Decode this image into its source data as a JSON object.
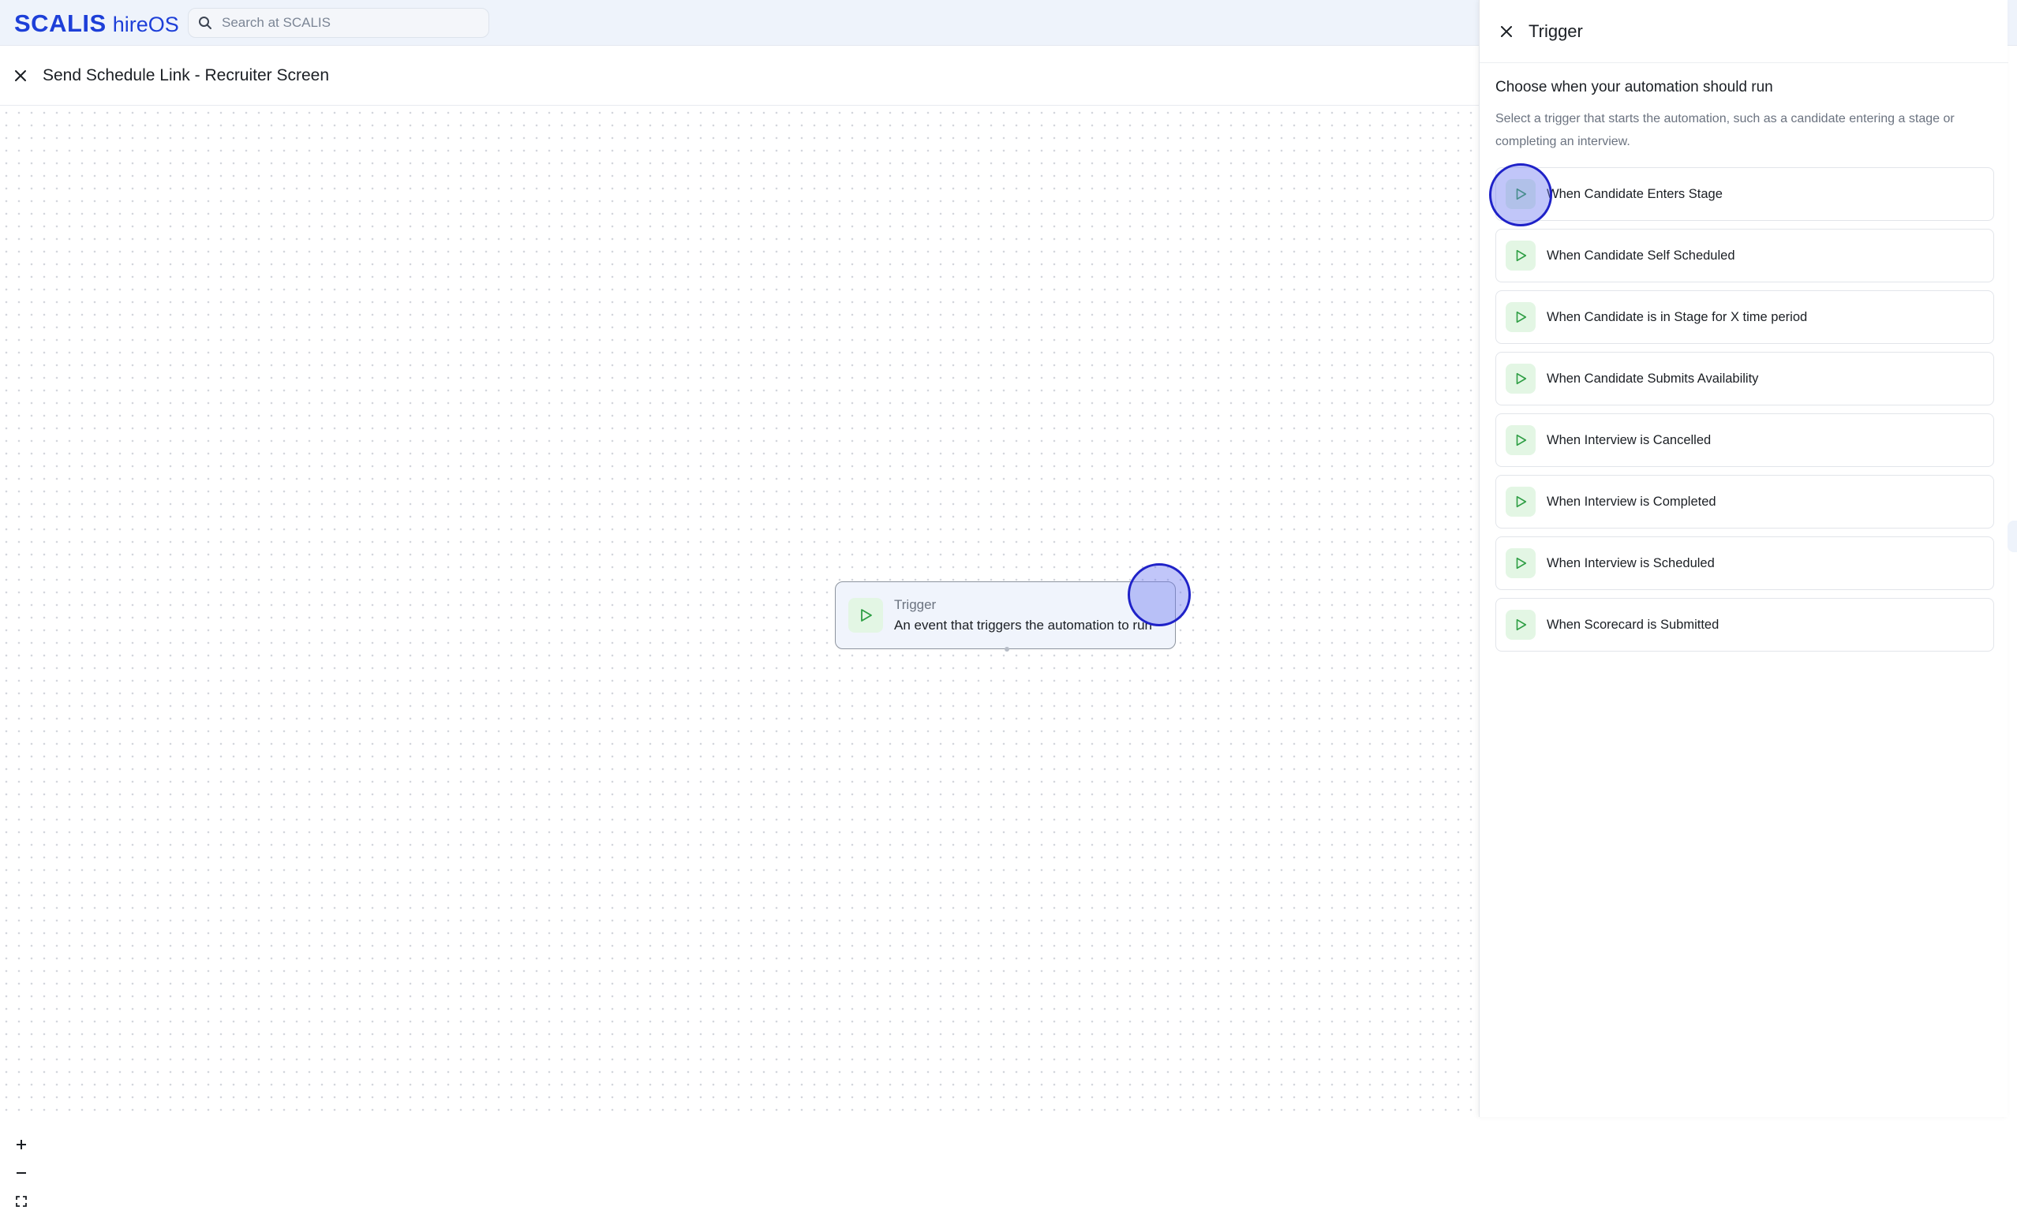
{
  "app": {
    "brand": "SCALIS",
    "product": "hireOS"
  },
  "search": {
    "placeholder": "Search at SCALIS",
    "value": ""
  },
  "workflow": {
    "title": "Send Schedule Link - Recruiter Screen"
  },
  "canvas": {
    "node": {
      "label": "Trigger",
      "description": "An event that triggers the automation to run",
      "icon": "play-icon"
    },
    "zoom_controls": [
      "zoom-in",
      "zoom-out",
      "fit-view"
    ]
  },
  "panel": {
    "title": "Trigger",
    "heading": "Choose when your automation should run",
    "description": "Select a trigger that starts the automation, such as a candidate entering a stage or completing an interview.",
    "triggers": [
      {
        "label": "When Candidate Enters Stage"
      },
      {
        "label": "When Candidate Self Scheduled"
      },
      {
        "label": "When Candidate is in Stage for X time period"
      },
      {
        "label": "When Candidate Submits Availability"
      },
      {
        "label": "When Interview is Cancelled"
      },
      {
        "label": "When Interview is Completed"
      },
      {
        "label": "When Interview is Scheduled"
      },
      {
        "label": "When Scorecard is Submitted"
      }
    ]
  },
  "colors": {
    "brand": "#1d3fd8",
    "trigger_icon_bg": "#e3f6e4",
    "trigger_icon": "#2e9e44",
    "click_marker": "#1f22c8"
  }
}
